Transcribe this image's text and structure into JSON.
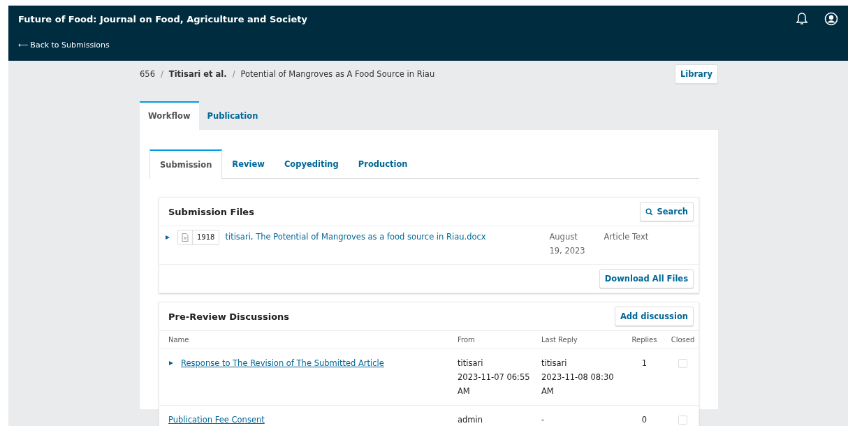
{
  "header": {
    "title": "Future of Food: Journal on Food, Agriculture and Society",
    "back_arrow": "⟵",
    "back_link": "Back to Submissions"
  },
  "breadcrumb": {
    "separator": "/",
    "id": "656",
    "authors": "Titisari et al.",
    "title": "Potential of Mangroves as A Food Source in Riau"
  },
  "library_button": "Library",
  "tabs": [
    {
      "label": "Workflow",
      "selected": true
    },
    {
      "label": "Publication",
      "selected": false
    }
  ],
  "stage_tabs": [
    {
      "label": "Submission",
      "selected": true
    },
    {
      "label": "Review",
      "selected": false
    },
    {
      "label": "Copyediting",
      "selected": false
    },
    {
      "label": "Production",
      "selected": false
    }
  ],
  "submission_files": {
    "title": "Submission Files",
    "search_button": "Search",
    "files": [
      {
        "expanded": false,
        "id": "1918",
        "name": "titisari, The Potential of Mangroves as a food source in Riau.docx",
        "date": "August 19, 2023",
        "type": "Article Text"
      }
    ],
    "download_button": "Download All Files"
  },
  "discussions": {
    "title": "Pre-Review Discussions",
    "add_button": "Add discussion",
    "columns": [
      "Name",
      "From",
      "Last Reply",
      "Replies",
      "Closed"
    ],
    "rows": [
      {
        "expandable": true,
        "name": "Response to The Revision of The Submitted Article",
        "from": [
          "titisari",
          "2023-11-07 06:55 AM"
        ],
        "last_reply": [
          "titisari",
          "2023-11-08 08:30 AM"
        ],
        "replies": "1",
        "closed": false
      },
      {
        "expandable": false,
        "name": "Publication Fee Consent",
        "from": [
          "admin"
        ],
        "last_reply": [
          "-"
        ],
        "replies": "0",
        "closed": false
      }
    ]
  }
}
